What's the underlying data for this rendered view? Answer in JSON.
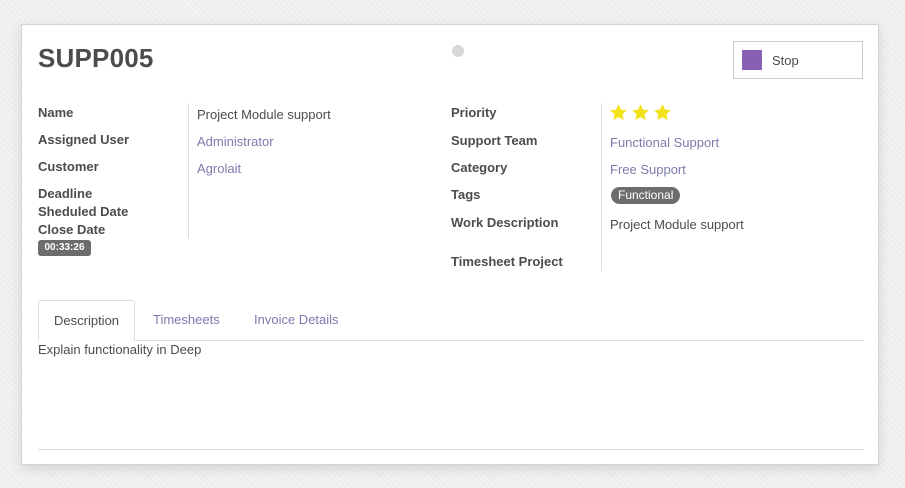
{
  "record": {
    "title": "SUPP005",
    "stop_label": "Stop",
    "accent_color": "#875fb3"
  },
  "left_fields": {
    "name_label": "Name",
    "name_value": "Project Module support",
    "assigned_user_label": "Assigned User",
    "assigned_user_value": "Administrator",
    "customer_label": "Customer",
    "customer_value": "Agrolait",
    "deadline_label": "Deadline",
    "scheduled_date_label": "Sheduled Date",
    "close_date_label": "Close Date",
    "timer": "00:33:26"
  },
  "right_fields": {
    "priority_label": "Priority",
    "priority_stars": 3,
    "support_team_label": "Support Team",
    "support_team_value": "Functional Support",
    "category_label": "Category",
    "category_value": "Free Support",
    "tags_label": "Tags",
    "tag_value": "Functional",
    "work_description_label": "Work Description",
    "work_description_value": "Project Module support",
    "timesheet_project_label": "Timesheet Project"
  },
  "tabs": [
    {
      "label": "Description"
    },
    {
      "label": "Timesheets"
    },
    {
      "label": "Invoice Details"
    }
  ],
  "description_text": "Explain functionality in Deep"
}
